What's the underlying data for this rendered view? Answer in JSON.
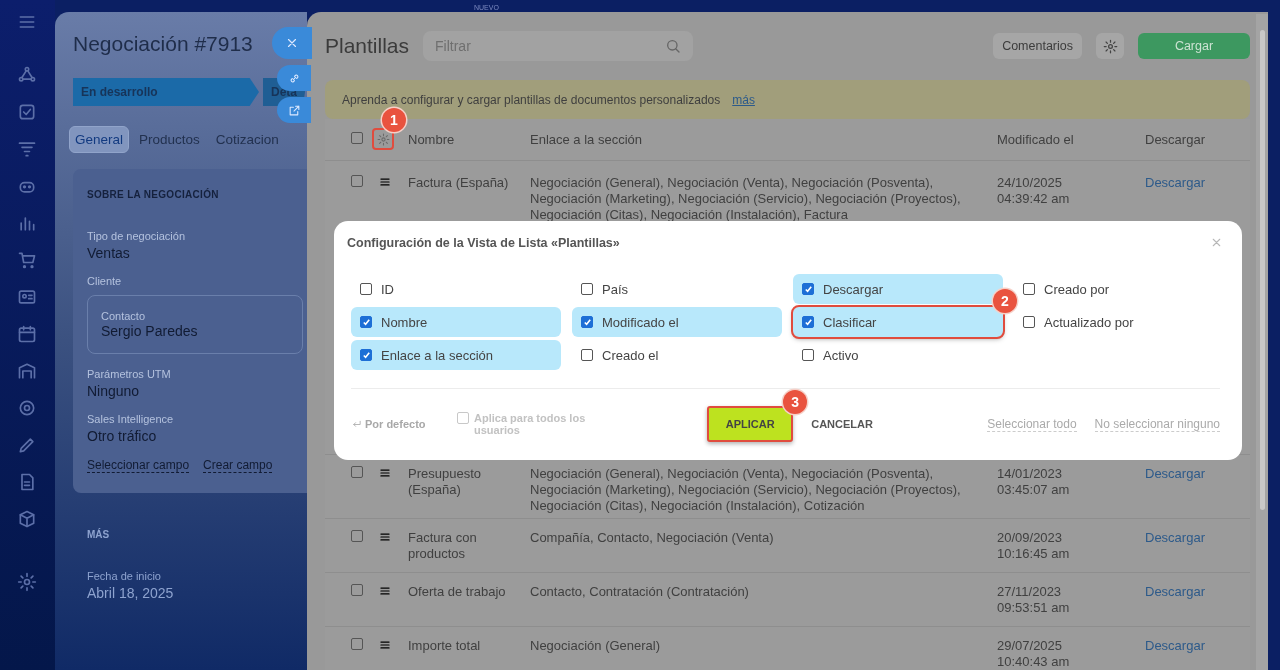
{
  "top_badge": "NUEVO",
  "deal": {
    "title": "Negociación #7913",
    "stages": [
      {
        "label": "En desarrollo",
        "selected": true
      },
      {
        "label": "Deta",
        "selected": false
      }
    ],
    "tabs": [
      {
        "label": "General",
        "selected": true
      },
      {
        "label": "Productos",
        "selected": false
      },
      {
        "label": "Cotizacion",
        "selected": false
      }
    ],
    "section_title": "SOBRE LA NEGOCIACIÓN",
    "fields": [
      {
        "label": "Tipo de negociación",
        "value": "Ventas"
      },
      {
        "label": "Cliente",
        "card_label": "Contacto",
        "card_value": "Sergio Paredes"
      },
      {
        "label": "Parámetros UTM",
        "value": "Ninguno"
      },
      {
        "label": "Sales Intelligence",
        "value": "Otro tráfico"
      }
    ],
    "field_links": [
      "Seleccionar campo",
      "Crear campo"
    ],
    "more_title": "MÁS",
    "more_fields": [
      {
        "label": "Fecha de inicio",
        "value": "Abril 18, 2025"
      }
    ]
  },
  "templates": {
    "title": "Plantillas",
    "search": {
      "placeholder": "Filtrar"
    },
    "buttons": [
      {
        "label": "Comentarios",
        "kind": "plain"
      },
      {
        "label": "Cargar",
        "kind": "primary"
      }
    ],
    "banner": {
      "text": "Aprenda a configurar y cargar plantillas de documentos personalizados",
      "link": "más"
    },
    "table": {
      "header_checked": false,
      "header_annotation": "1",
      "columns": [
        "Nombre",
        "Enlace a la sección",
        "Modificado el",
        "Descargar"
      ],
      "rows": [
        {
          "name": "Factura (España)",
          "sections": "Negociación (General), Negociación (Venta), Negociación (Posventa), Negociación (Marketing), Negociación (Servicio), Negociación (Proyectos), Negociación (Citas), Negociación (Instalación), Factura",
          "modified": "24/10/2025 04:39:42 am",
          "download": "Descargar",
          "checked": false
        },
        {
          "name": "Presupuesto (España)",
          "sections": "Negociación (General), Negociación (Venta), Negociación (Posventa), Negociación (Marketing), Negociación (Servicio), Negociación (Proyectos), Negociación (Citas), Negociación (Instalación), Cotización",
          "modified": "14/01/2023 03:45:07 am",
          "download": "Descargar",
          "checked": false
        },
        {
          "name": "Factura con productos",
          "sections": "Compañía, Contacto, Negociación (Venta)",
          "modified": "20/09/2023 10:16:45 am",
          "download": "Descargar",
          "checked": false
        },
        {
          "name": "Oferta de trabajo",
          "sections": "Contacto, Contratación (Contratación)",
          "modified": "27/11/2023 09:53:51 am",
          "download": "Descargar",
          "checked": false
        },
        {
          "name": "Importe total",
          "sections": "Negociación (General)",
          "modified": "29/07/2025 10:40:43 am",
          "download": "Descargar",
          "checked": false
        }
      ]
    }
  },
  "modal": {
    "title": "Configuración de la Vista de Lista «Plantillas»",
    "options": [
      {
        "label": "ID",
        "checked": false
      },
      {
        "label": "País",
        "checked": false
      },
      {
        "label": "Descargar",
        "checked": true
      },
      {
        "label": "Creado por",
        "checked": false
      },
      {
        "label": "Nombre",
        "checked": true
      },
      {
        "label": "Modificado el",
        "checked": true
      },
      {
        "label": "Clasificar",
        "checked": true,
        "annotation": "2"
      },
      {
        "label": "Actualizado por",
        "checked": false
      },
      {
        "label": "Enlace a la sección",
        "checked": true
      },
      {
        "label": "Creado el",
        "checked": false
      },
      {
        "label": "Activo",
        "checked": false
      }
    ],
    "default_link": "Por defecto",
    "apply_all": {
      "label": "Aplica para todos los usuarios",
      "checked": false
    },
    "apply": {
      "label": "APLICAR",
      "annotation": "3"
    },
    "cancel": "CANCELAR",
    "select_all": "Seleccionar todo",
    "select_none": "No seleccionar ninguno"
  }
}
